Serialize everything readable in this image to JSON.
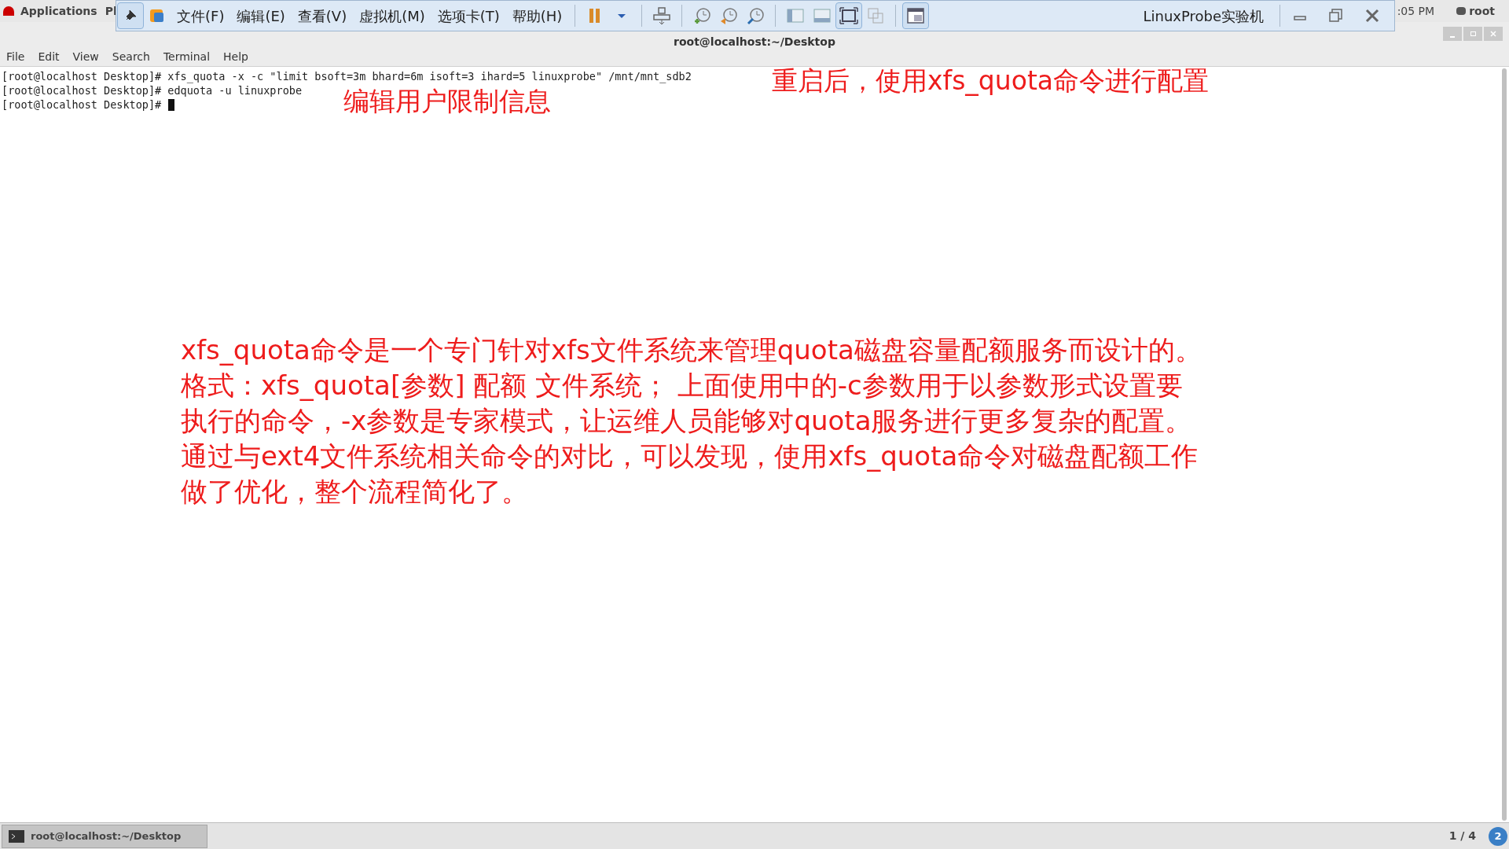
{
  "top_bar": {
    "applications": "Applications",
    "places": "Pl",
    "clock": ":05 PM",
    "user": "root"
  },
  "vm_toolbar": {
    "menus": [
      "文件(F)",
      "编辑(E)",
      "查看(V)",
      "虚拟机(M)",
      "选项卡(T)",
      "帮助(H)"
    ],
    "title": "LinuxProbe实验机"
  },
  "terminal": {
    "title": "root@localhost:~/Desktop",
    "menus": [
      "File",
      "Edit",
      "View",
      "Search",
      "Terminal",
      "Help"
    ],
    "lines": [
      {
        "prompt": "[root@localhost Desktop]#",
        "command": "xfs_quota -x -c \"limit bsoft=3m bhard=6m isoft=3 ihard=5 linuxprobe\" /mnt/mnt_sdb2",
        "cursor": false
      },
      {
        "prompt": "[root@localhost Desktop]#",
        "command": "edquota -u linuxprobe",
        "cursor": false
      },
      {
        "prompt": "[root@localhost Desktop]#",
        "cursor": true
      }
    ]
  },
  "annotations": [
    {
      "kind": "note",
      "lines": [
        "重启后，使用xfs_quota命令进行配置"
      ]
    },
    {
      "kind": "note",
      "lines": [
        "编辑用户限制信息"
      ]
    },
    {
      "kind": "paragraph",
      "lines": [
        "xfs_quota命令是一个专门针对xfs文件系统来管理quota磁盘容量配额服务而设计的。",
        "格式：xfs_quota[参数] 配额 文件系统； 上面使用中的-c参数用于以参数形式设置要",
        "执行的命令，-x参数是专家模式，让运维人员能够对quota服务进行更多复杂的配置。",
        "通过与ext4文件系统相关命令的对比，可以发现，使用xfs_quota命令对磁盘配额工作",
        "做了优化，整个流程简化了。"
      ]
    }
  ],
  "taskbar": {
    "task": "root@localhost:~/Desktop",
    "pager": "1 / 4",
    "notifications": "2"
  }
}
